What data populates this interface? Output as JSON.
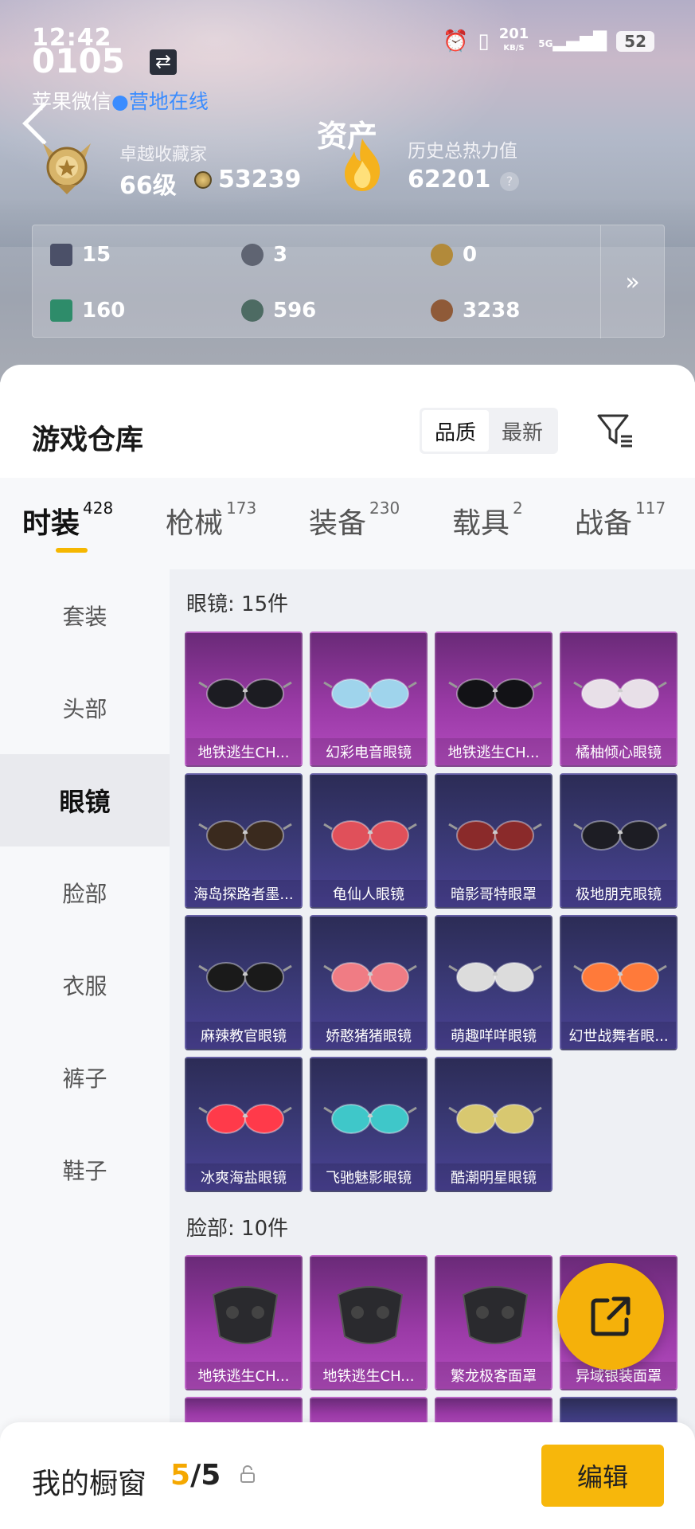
{
  "status_bar": {
    "time": "12:42",
    "time_big": "0105",
    "speed": "201",
    "speed_unit": "KB/S",
    "network": "5G",
    "battery": "52"
  },
  "header": {
    "account": "苹果微信",
    "online": "营地在线",
    "title": "资产",
    "level_title": "卓越收藏家",
    "level": "66级",
    "coins": "53239",
    "heat_title": "历史总热力值",
    "heat": "62201",
    "help": "?"
  },
  "stats": [
    {
      "value": "15",
      "icon": "card-icon",
      "color": "#4b5068"
    },
    {
      "value": "3",
      "icon": "silver-coin-icon",
      "color": "#5f6472"
    },
    {
      "value": "0",
      "icon": "gold-coin-icon",
      "color": "#b28a3a"
    },
    {
      "value": "160",
      "icon": "ticket-icon",
      "color": "#2e8c6a"
    },
    {
      "value": "596",
      "icon": "token-icon",
      "color": "#4d6b63"
    },
    {
      "value": "3238",
      "icon": "bronze-coin-icon",
      "color": "#8f5a38"
    }
  ],
  "warehouse": {
    "title": "游戏仓库",
    "sort_quality": "品质",
    "sort_latest": "最新"
  },
  "tabs": [
    {
      "label": "时装",
      "count": "428"
    },
    {
      "label": "枪械",
      "count": "173"
    },
    {
      "label": "装备",
      "count": "230"
    },
    {
      "label": "载具",
      "count": "2"
    },
    {
      "label": "战备",
      "count": "117"
    }
  ],
  "side_menu": [
    "套装",
    "头部",
    "眼镜",
    "脸部",
    "衣服",
    "裤子",
    "鞋子"
  ],
  "sections": [
    {
      "title": "眼镜: 15件"
    },
    {
      "title": "脸部: 10件"
    }
  ],
  "glasses": [
    {
      "name": "地铁逃生CH...",
      "tier": "purple"
    },
    {
      "name": "幻彩电音眼镜",
      "tier": "purple"
    },
    {
      "name": "地铁逃生CH...",
      "tier": "purple"
    },
    {
      "name": "橘柚倾心眼镜",
      "tier": "purple"
    },
    {
      "name": "海岛探路者墨...",
      "tier": "blue"
    },
    {
      "name": "龟仙人眼镜",
      "tier": "blue"
    },
    {
      "name": "暗影哥特眼罩",
      "tier": "blue"
    },
    {
      "name": "极地朋克眼镜",
      "tier": "blue"
    },
    {
      "name": "麻辣教官眼镜",
      "tier": "blue"
    },
    {
      "name": "娇憨猪猪眼镜",
      "tier": "blue"
    },
    {
      "name": "萌趣咩咩眼镜",
      "tier": "blue"
    },
    {
      "name": "幻世战舞者眼...",
      "tier": "blue"
    },
    {
      "name": "冰爽海盐眼镜",
      "tier": "blue"
    },
    {
      "name": "飞驰魅影眼镜",
      "tier": "blue"
    },
    {
      "name": "酷潮明星眼镜",
      "tier": "blue"
    }
  ],
  "face": [
    {
      "name": "地铁逃生CH...",
      "tier": "purple"
    },
    {
      "name": "地铁逃生CH...",
      "tier": "purple"
    },
    {
      "name": "繁龙极客面罩",
      "tier": "purple"
    },
    {
      "name": "异域银装面罩",
      "tier": "purple"
    }
  ],
  "bottom": {
    "label": "我的橱窗",
    "count_current": "5",
    "count_sep": "/",
    "count_total": "5",
    "edit": "编辑"
  }
}
